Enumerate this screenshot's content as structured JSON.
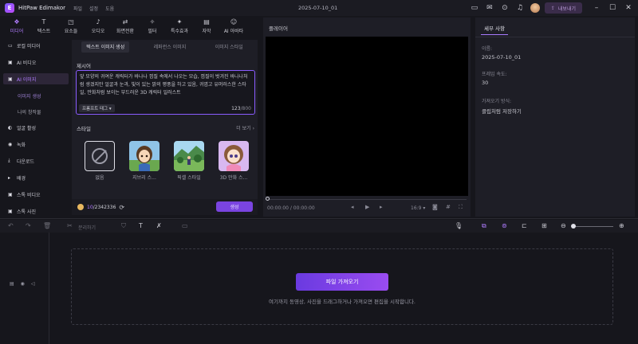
{
  "app": {
    "name": "HitPaw Edimakor",
    "doc_title": "2025-07-10_01"
  },
  "menu": [
    "파일",
    "설정",
    "도움"
  ],
  "titlebar": {
    "export_label": "내보내기"
  },
  "tooltabs": [
    {
      "label": "미디어",
      "icon": "media-icon",
      "glyph": "❖",
      "active": true
    },
    {
      "label": "텍스트",
      "icon": "text-icon",
      "glyph": "T",
      "active": false
    },
    {
      "label": "요소들",
      "icon": "elements-icon",
      "glyph": "◳",
      "active": false
    },
    {
      "label": "오디오",
      "icon": "audio-icon",
      "glyph": "♪",
      "active": false
    },
    {
      "label": "화면전환",
      "icon": "transition-icon",
      "glyph": "⇄",
      "active": false
    },
    {
      "label": "필터",
      "icon": "filter-icon",
      "glyph": "✧",
      "active": false
    },
    {
      "label": "특수효과",
      "icon": "effects-icon",
      "glyph": "✦",
      "active": false
    },
    {
      "label": "자막",
      "icon": "subtitle-icon",
      "glyph": "▤",
      "active": false
    },
    {
      "label": "AI 아바타",
      "icon": "ai-avatar-icon",
      "glyph": "☺",
      "active": false
    }
  ],
  "leftnav": {
    "items": [
      {
        "label": "로컬 미디어",
        "glyph": "▭",
        "active": false
      },
      {
        "label": "AI 비디오",
        "glyph": "▣",
        "active": false
      },
      {
        "label": "AI 이미지",
        "glyph": "▣",
        "active": true
      }
    ],
    "subitems": [
      {
        "label": "이미지 생성",
        "active": true
      },
      {
        "label": "나의 창작물",
        "active": false
      }
    ],
    "items2": [
      {
        "label": "얼굴 활성",
        "glyph": "◐"
      },
      {
        "label": "녹화",
        "glyph": "◉"
      },
      {
        "label": "다운로드",
        "glyph": "⤓"
      },
      {
        "label": "배경",
        "glyph": "▸"
      },
      {
        "label": "스톡 비디오",
        "glyph": "▣"
      },
      {
        "label": "스톡 사진",
        "glyph": "▣"
      }
    ]
  },
  "center": {
    "subtabs": [
      "텍스트 이미지 생성",
      "레퍼런스 이미지",
      "이미지 스타일"
    ],
    "prompt_label": "제시어",
    "prompt_text": "앞 모양의 귀여운 캐릭터가 바나나 껍질 속에서 나오는 모습, 껍질이 벗겨진 바나나처럼 생겼지만 얼굴과 눈과, 빛이 있는 밝의 평풍을 하고 있음, 귀엽고 유머러스한 스타일, 만화처럼 보이는 부드러운 3D 캐릭터 일러스트",
    "prompt_tag": "프롬프트 태그 ▾",
    "count_used": "123",
    "count_max": "/800",
    "style_label": "스타일",
    "more_label": "더 보기",
    "styles": [
      {
        "name": "없음",
        "kind": "none"
      },
      {
        "name": "지브리 스...",
        "kind": "ghibli-girl"
      },
      {
        "name": "픽셀 스타일",
        "kind": "ghibli-landscape"
      },
      {
        "name": "3D 만화 스...",
        "kind": "3d-cartoon"
      }
    ],
    "credits_used": "10",
    "credits_total": "/2342336",
    "generate_label": "생성"
  },
  "player": {
    "title": "플레이어",
    "time": "00:00:00 / 00:00:00",
    "ratio": "16:9"
  },
  "props": {
    "tab": "세부 사항",
    "fields": [
      {
        "label": "이름:",
        "value": "2025-07-10_01"
      },
      {
        "label": "프레임 속도:",
        "value": "30"
      },
      {
        "label": "가져오기 방식:",
        "value": "클립처럼 저장하기"
      }
    ]
  },
  "timeline": {
    "split_label": "분리하기",
    "import_label": "파일 가져오기",
    "drop_hint": "여기까지 동영상, 사진을 드래그하거나 가져오면 편집을 시작합니다."
  },
  "colors": {
    "accent": "#b07cff",
    "button": "#7a44e0"
  }
}
